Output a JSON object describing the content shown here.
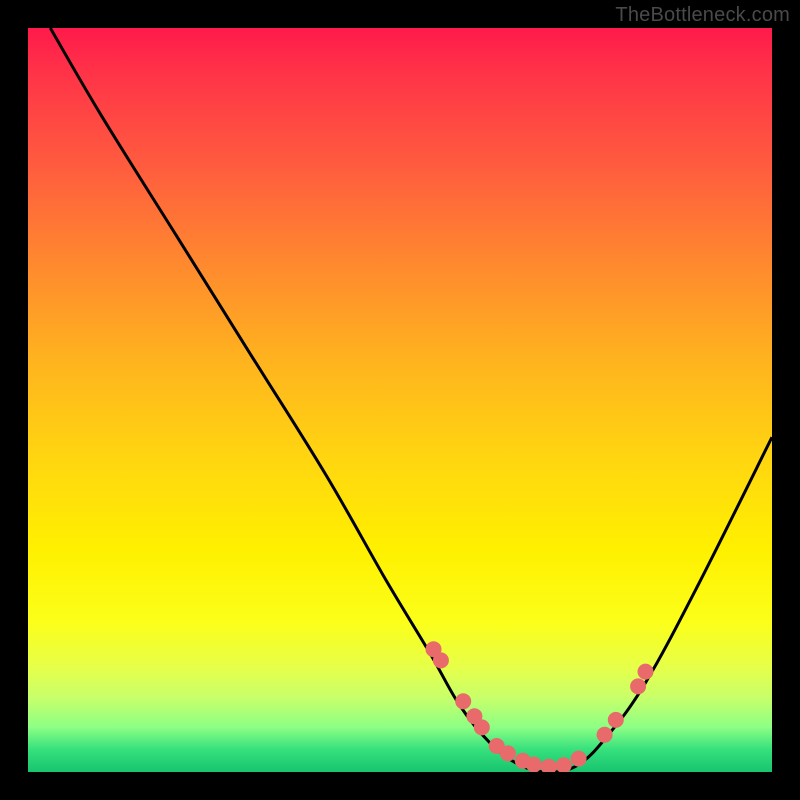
{
  "watermark": "TheBottleneck.com",
  "gradient_colors": {
    "top": "#ff1a4b",
    "mid_upper": "#ff8a2e",
    "mid": "#ffd610",
    "mid_lower": "#fbff1a",
    "bottom": "#18c46e"
  },
  "curve_color": "#000000",
  "marker_color": "#e96a6a",
  "chart_data": {
    "type": "line",
    "title": "",
    "xlabel": "",
    "ylabel": "",
    "xlim": [
      0,
      100
    ],
    "ylim": [
      0,
      100
    ],
    "annotations": [
      "TheBottleneck.com"
    ],
    "series": [
      {
        "name": "bottleneck-curve",
        "x": [
          3,
          10,
          20,
          30,
          40,
          48,
          54,
          58,
          62,
          66,
          70,
          74,
          78,
          83,
          90,
          100
        ],
        "values": [
          100,
          88,
          72,
          56,
          40,
          26,
          16,
          9,
          4,
          1,
          0,
          1,
          5,
          12,
          25,
          45
        ]
      }
    ],
    "markers": {
      "name": "highlighted-points",
      "x": [
        54.5,
        55.5,
        58.5,
        60,
        61,
        63,
        64.5,
        66.5,
        68,
        70,
        72,
        74,
        77.5,
        79,
        82,
        83
      ],
      "values": [
        16.5,
        15,
        9.5,
        7.5,
        6,
        3.5,
        2.5,
        1.5,
        1,
        0.7,
        0.9,
        1.8,
        5,
        7,
        11.5,
        13.5
      ]
    }
  }
}
